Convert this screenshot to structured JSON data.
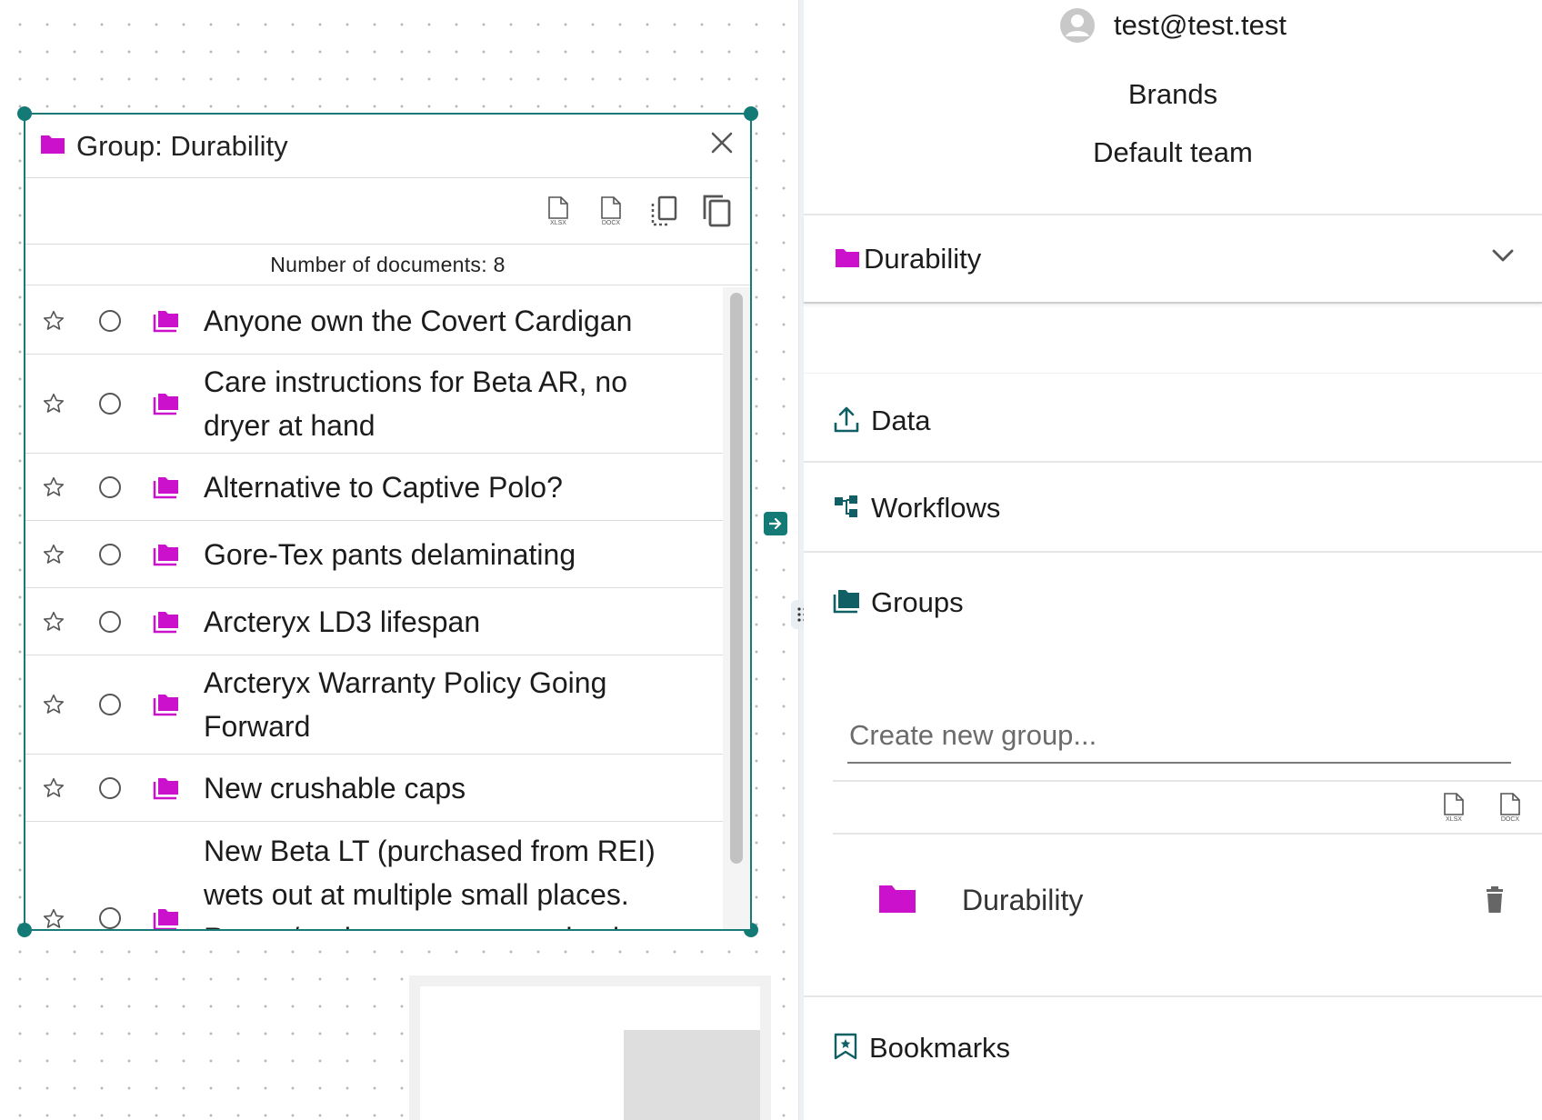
{
  "colors": {
    "accent": "#137a76",
    "folder": "#cc11cc",
    "folder_dark": "#0f5f65"
  },
  "group_window": {
    "title": "Group: Durability",
    "toolbar": {
      "xlsx_label": "XLSX",
      "docx_label": "DOCX"
    },
    "doc_count_text": "Number of documents: 8",
    "documents": [
      {
        "title": "Anyone own the Covert Cardigan"
      },
      {
        "title": "Care instructions for Beta AR, no dryer at hand"
      },
      {
        "title": "Alternative to Captive Polo?"
      },
      {
        "title": "Gore-Tex pants delaminating"
      },
      {
        "title": "Arcteryx LD3 lifespan"
      },
      {
        "title": "Arcteryx Warranty Policy Going Forward"
      },
      {
        "title": "New crushable caps"
      },
      {
        "title": "New Beta LT (purchased from REI) wets out at multiple small places. Return/exchange or try treating it"
      }
    ]
  },
  "sidebar": {
    "user_email": "test@test.test",
    "brands_label": "Brands",
    "team_label": "Default team",
    "selected_group": "Durability",
    "sections": {
      "data": "Data",
      "workflows": "Workflows",
      "groups": "Groups",
      "bookmarks": "Bookmarks"
    },
    "new_group_placeholder": "Create new group...",
    "export": {
      "xlsx_label": "XLSX",
      "docx_label": "DOCX"
    },
    "groups": [
      {
        "name": "Durability"
      }
    ]
  }
}
